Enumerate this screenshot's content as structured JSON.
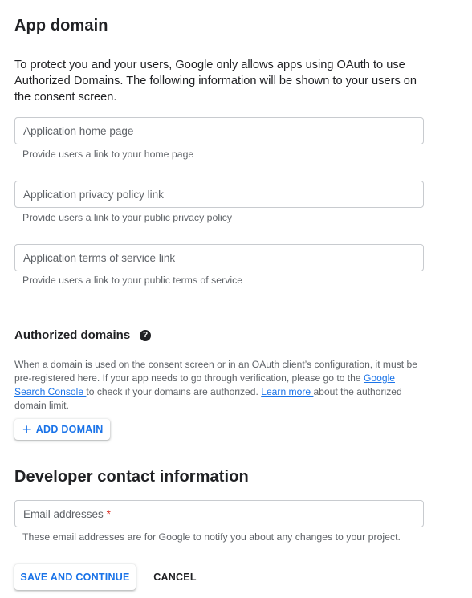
{
  "app_domain": {
    "title": "App domain",
    "intro": "To protect you and your users, Google only allows apps using OAuth to use Authorized Domains. The following information will be shown to your users on the consent screen.",
    "fields": [
      {
        "placeholder": "Application home page",
        "value": "",
        "hint": "Provide users a link to your home page"
      },
      {
        "placeholder": "Application privacy policy link",
        "value": "",
        "hint": "Provide users a link to your public privacy policy"
      },
      {
        "placeholder": "Application terms of service link",
        "value": "",
        "hint": "Provide users a link to your public terms of service"
      }
    ]
  },
  "authorized_domains": {
    "title": "Authorized domains",
    "help_icon": "help-circle-icon",
    "text_part1": "When a domain is used on the consent screen or in an OAuth client’s configuration, it must be pre-registered here. If your app needs to go through verification, please go to the ",
    "link1": "Google Search Console ",
    "text_part2": "to check if your domains are authorized. ",
    "link2": "Learn more ",
    "text_part3": "about the authorized domain limit.",
    "add_button_icon": "plus-icon",
    "add_button_label": "ADD DOMAIN"
  },
  "developer_contact": {
    "title": "Developer contact information",
    "email_placeholder": "Email addresses",
    "required_marker": "*",
    "email_value": "",
    "hint": "These email addresses are for Google to notify you about any changes to your project."
  },
  "actions": {
    "save_label": "SAVE AND CONTINUE",
    "cancel_label": "CANCEL"
  },
  "colors": {
    "accent": "#1a73e8",
    "text_primary": "#202124",
    "text_secondary": "#5f6368",
    "required": "#d93025",
    "border": "#c8cbcf"
  }
}
